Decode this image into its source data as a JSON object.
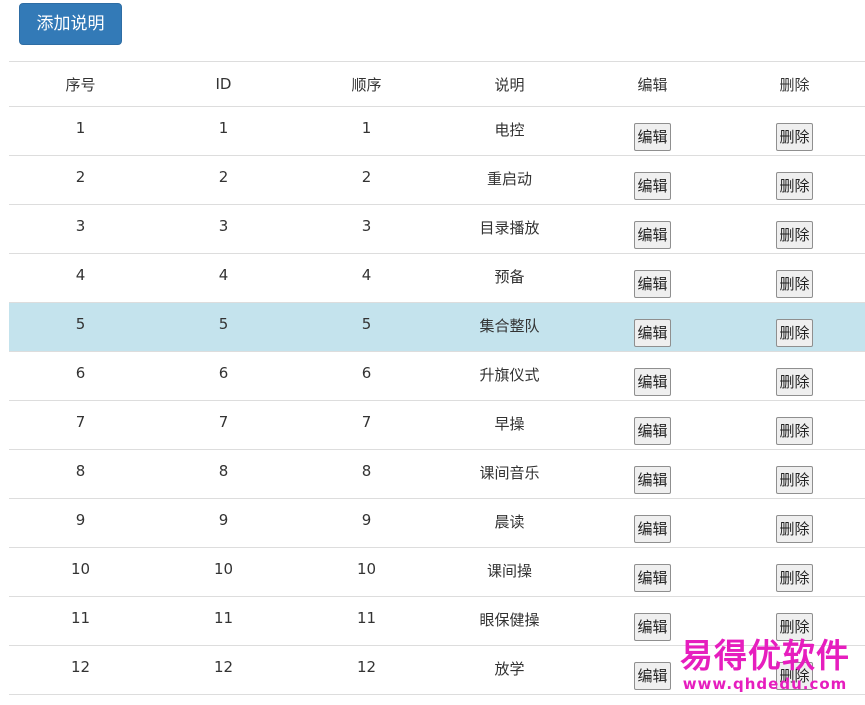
{
  "toolbar": {
    "add_label": "添加说明"
  },
  "table": {
    "headers": [
      "序号",
      "ID",
      "顺序",
      "说明",
      "编辑",
      "删除"
    ],
    "edit_label": "编辑",
    "delete_label": "删除",
    "rows": [
      {
        "index": "1",
        "id": "1",
        "order": "1",
        "desc": "电控"
      },
      {
        "index": "2",
        "id": "2",
        "order": "2",
        "desc": "重启动"
      },
      {
        "index": "3",
        "id": "3",
        "order": "3",
        "desc": "目录播放"
      },
      {
        "index": "4",
        "id": "4",
        "order": "4",
        "desc": "预备"
      },
      {
        "index": "5",
        "id": "5",
        "order": "5",
        "desc": "集合整队",
        "highlighted": true
      },
      {
        "index": "6",
        "id": "6",
        "order": "6",
        "desc": "升旗仪式"
      },
      {
        "index": "7",
        "id": "7",
        "order": "7",
        "desc": "早操"
      },
      {
        "index": "8",
        "id": "8",
        "order": "8",
        "desc": "课间音乐"
      },
      {
        "index": "9",
        "id": "9",
        "order": "9",
        "desc": "晨读"
      },
      {
        "index": "10",
        "id": "10",
        "order": "10",
        "desc": "课间操"
      },
      {
        "index": "11",
        "id": "11",
        "order": "11",
        "desc": "眼保健操"
      },
      {
        "index": "12",
        "id": "12",
        "order": "12",
        "desc": "放学"
      }
    ]
  },
  "watermark": {
    "title": "易得优软件",
    "url": "www.qhdedu.com"
  },
  "colors": {
    "primary": "#337ab7",
    "highlight_row": "#c4e3ed",
    "watermark": "#e61ebe"
  }
}
